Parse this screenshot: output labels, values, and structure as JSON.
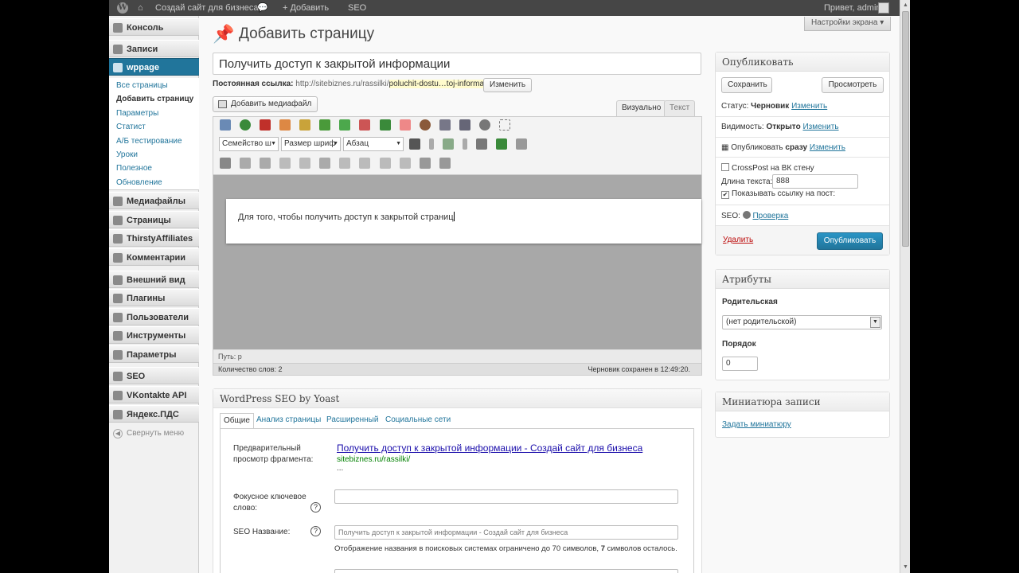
{
  "adminbar": {
    "site_name": "Создай сайт для бизнеса",
    "add_new": "+ Добавить",
    "seo": "SEO",
    "greeting": "Привет, admin"
  },
  "screen_options": "Настройки экрана ▾",
  "sidebar": {
    "items": {
      "console": "Консоль",
      "posts": "Записи",
      "wppage": "wppage",
      "media": "Медиафайлы",
      "pages": "Страницы",
      "thirsty": "ThirstyAffiliates",
      "comments": "Комментарии",
      "appearance": "Внешний вид",
      "plugins": "Плагины",
      "users": "Пользователи",
      "tools": "Инструменты",
      "settings": "Параметры",
      "seo": "SEO",
      "vk": "VKontakte API",
      "yandex": "Яндекс.ПДС"
    },
    "submenu": [
      "Все страницы",
      "Добавить страницу",
      "Параметры",
      "Статист",
      "А/Б тестирование",
      "Уроки",
      "Полезное",
      "Обновление"
    ],
    "collapse": "Свернуть меню"
  },
  "page": {
    "title": "Добавить страницу"
  },
  "post": {
    "title": "Получить доступ к закрытой информации",
    "permalink_label": "Постоянная ссылка:",
    "permalink_base": "http://sitebiznes.ru/rassilki/",
    "permalink_slug": "poluchit-dostu…toj-informaci",
    "edit_button": "Изменить"
  },
  "editor": {
    "add_media": "Добавить медиафайл",
    "tab_visual": "Визуально",
    "tab_text": "Текст",
    "font_family": "Семейство ш",
    "font_size": "Размер шриф",
    "format": "Абзац",
    "content": "Для того, чтобы получить доступ к закрытой страниц",
    "path": "Путь: p",
    "word_count": "Количество слов: 2",
    "draft_saved": "Черновик сохранен в 12:49:20."
  },
  "publish": {
    "title": "Опубликовать",
    "save": "Сохранить",
    "preview": "Просмотреть",
    "status_label": "Статус:",
    "status_value": "Черновик",
    "visibility_label": "Видимость:",
    "visibility_value": "Открыто",
    "publish_label": "Опубликовать",
    "publish_value": "сразу",
    "change": "Изменить",
    "crosspost": "CrossPost на ВК стену",
    "text_length_label": "Длина текста:",
    "text_length_value": "888",
    "show_link": "Показывать ссылку на пост:",
    "seo_label": "SEO:",
    "seo_check": "Проверка",
    "delete": "Удалить",
    "publish_button": "Опубликовать"
  },
  "attributes": {
    "title": "Атрибуты",
    "parent_label": "Родительская",
    "parent_value": "(нет родительской)",
    "order_label": "Порядок",
    "order_value": "0"
  },
  "thumbnail": {
    "title": "Миниатюра записи",
    "set": "Задать миниатюру"
  },
  "yoast": {
    "title": "WordPress SEO by Yoast",
    "tabs": [
      "Общие",
      "Анализ страницы",
      "Расширенный",
      "Социальные сети"
    ],
    "snippet_label": "Предварительный просмотр фрагмента:",
    "snippet_title": "Получить доступ к закрытой информации - Создай сайт для бизнеса",
    "snippet_url": "sitebiznes.ru/rassilki/",
    "snippet_desc": "...",
    "focus_label": "Фокусное ключевое слово:",
    "focus_value": "",
    "seo_title_label": "SEO Название:",
    "seo_title_placeholder": "Получить доступ к закрытой информации - Создай сайт для бизнеса",
    "hint_prefix": "Отображение названия в поисковых системах ограничено до 70 символов,",
    "hint_count": "7",
    "hint_suffix": "символов осталось."
  },
  "colors": {
    "accent": "#21759b",
    "adminbar": "#464646",
    "editor_bg": "#a8a8a8"
  }
}
